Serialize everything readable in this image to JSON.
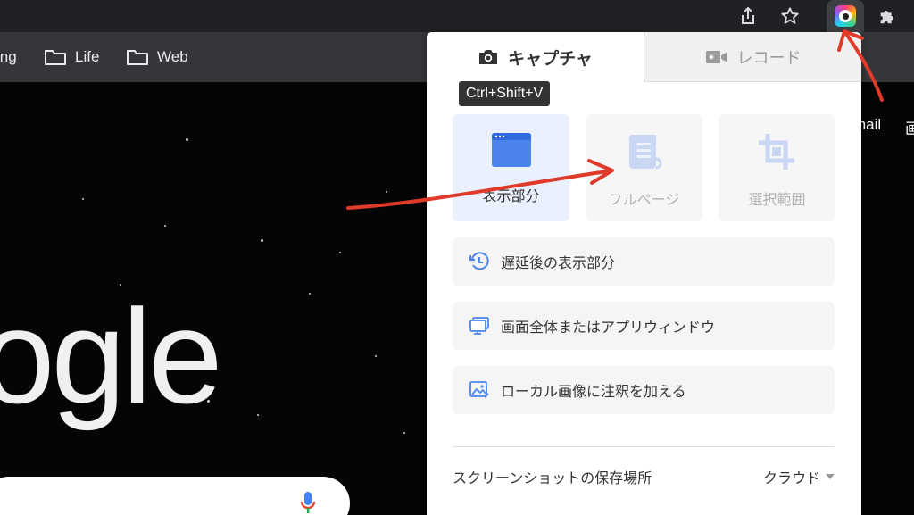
{
  "bookmarks": {
    "items": [
      {
        "label": "ing"
      },
      {
        "label": "Life"
      },
      {
        "label": "Web"
      }
    ]
  },
  "toolbar": {
    "icons": [
      "share-icon",
      "bookmark-star-icon",
      "screenshot-extension-icon",
      "extensions-puzzle-icon"
    ]
  },
  "page": {
    "logo_partial": "ogle",
    "nav_partial": [
      "mail",
      "画"
    ]
  },
  "popup": {
    "tabs": {
      "capture": "キャプチャ",
      "record": "レコード"
    },
    "tooltip": "Ctrl+Shift+V",
    "modes": [
      {
        "label": "表示部分",
        "icon": "browser-window-icon",
        "active": true
      },
      {
        "label": "フルページ",
        "icon": "scroll-page-icon",
        "active": false
      },
      {
        "label": "選択範囲",
        "icon": "crop-icon",
        "active": false
      }
    ],
    "options": [
      {
        "label": "遅延後の表示部分",
        "icon": "delay-clock-icon"
      },
      {
        "label": "画面全体またはアプリウィンドウ",
        "icon": "desktop-icon"
      },
      {
        "label": "ローカル画像に注釈を加える",
        "icon": "image-annotate-icon"
      }
    ],
    "save_location_label": "スクリーンショットの保存場所",
    "save_location_value": "クラウド"
  },
  "colors": {
    "accent_blue": "#4b84ed",
    "annotation_red": "#e03a2a",
    "toolbar_bg": "#202124",
    "bookmarks_bg": "#35363a"
  }
}
